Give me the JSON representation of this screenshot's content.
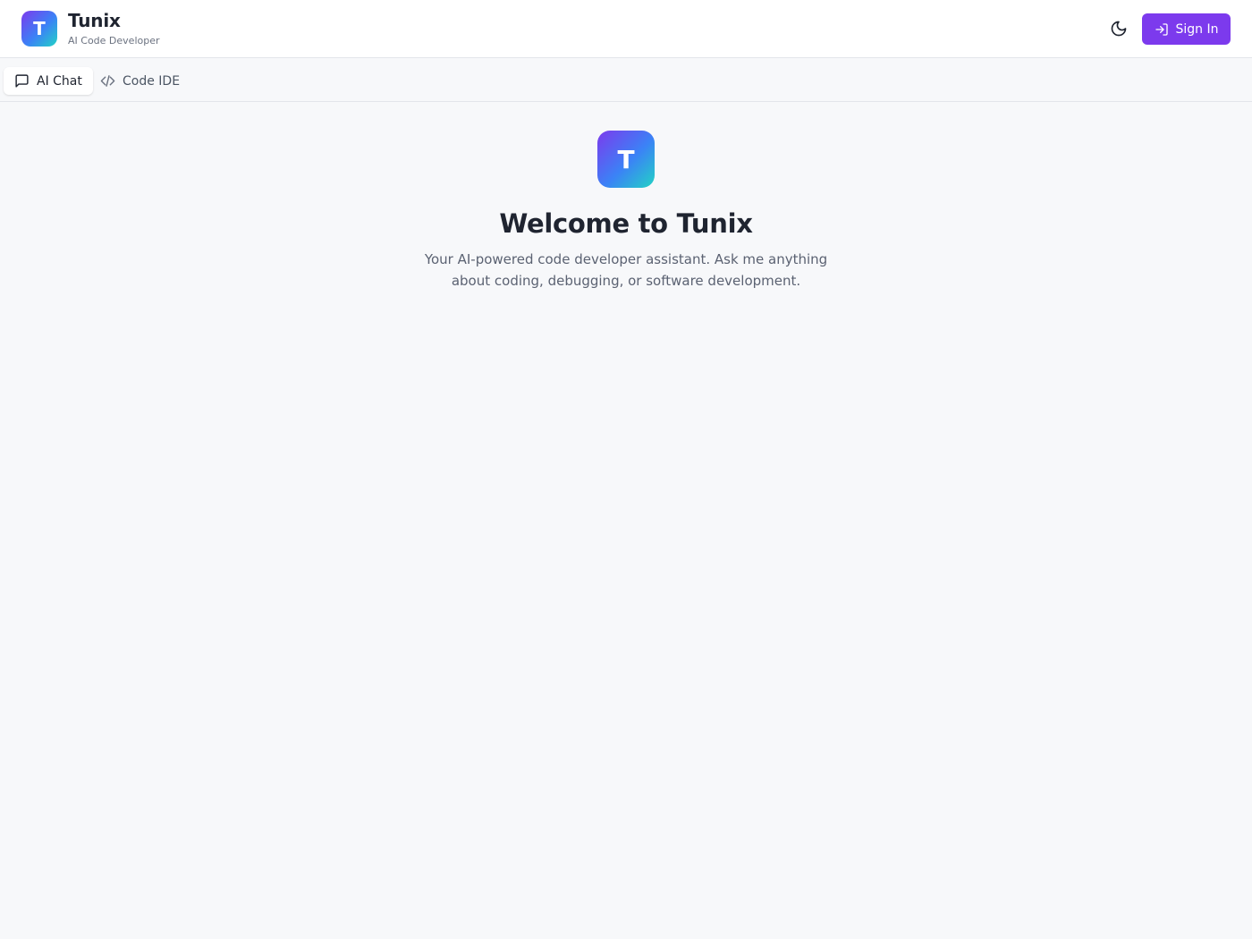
{
  "app": {
    "logo_letter": "T",
    "name": "Tunix",
    "subtitle": "AI Code Developer"
  },
  "header": {
    "theme_toggle_icon": "moon-icon",
    "signin_icon": "sign-in-icon",
    "signin_label": "Sign In"
  },
  "tabs": [
    {
      "label": "AI Chat",
      "icon": "chat-bubble-icon",
      "active": true
    },
    {
      "label": "Code IDE",
      "icon": "code-icon",
      "active": false
    }
  ],
  "welcome": {
    "logo_letter": "T",
    "title": "Welcome to Tunix",
    "description": "Your AI-powered code developer assistant. Ask me anything about coding, debugging, or software development."
  },
  "colors": {
    "accent": "#7c3aed",
    "background": "#f7f8fa",
    "header_background": "#ffffff",
    "gradient_start": "#7c3aed",
    "gradient_end": "#22d3c5"
  }
}
